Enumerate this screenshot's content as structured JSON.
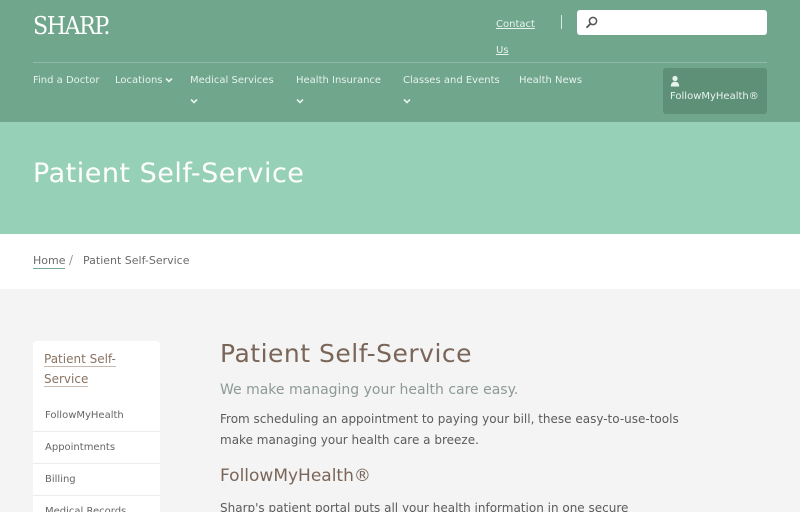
{
  "header": {
    "logo": "SHARP.",
    "contact_link": "Contact Us",
    "search": {
      "placeholder": ""
    },
    "nav": [
      {
        "label": "Find a Doctor",
        "has_dropdown": false
      },
      {
        "label": "Locations",
        "has_dropdown": true
      },
      {
        "label": "Medical Services",
        "has_dropdown": true
      },
      {
        "label": "Health Insurance",
        "has_dropdown": true
      },
      {
        "label": "Classes and Events",
        "has_dropdown": true
      },
      {
        "label": "Health News",
        "has_dropdown": false
      }
    ],
    "portal_button": "FollowMyHealth®"
  },
  "banner": {
    "title": "Patient Self-Service"
  },
  "breadcrumb": {
    "home": "Home",
    "separator": "/",
    "current": "Patient Self-Service"
  },
  "sidebar": {
    "title": "Patient Self-Service",
    "items": [
      "FollowMyHealth",
      "Appointments",
      "Billing",
      "Medical Records"
    ]
  },
  "main": {
    "title": "Patient Self-Service",
    "subtitle": "We make managing your health care easy.",
    "intro": "From scheduling an appointment to paying your bill, these easy-to-use-tools make managing your health care a breeze.",
    "section_title": "FollowMyHealth®",
    "section_text": "Sharp's patient portal puts all your health information in one secure"
  },
  "colors": {
    "header_bg": "#6fa68c",
    "banner_bg": "#96d1b7",
    "portal_button_bg": "#5e9078",
    "heading_brown": "#7a6659"
  },
  "icons": {
    "search": "search-icon",
    "chevron": "chevron-down-icon",
    "user": "user-icon"
  }
}
